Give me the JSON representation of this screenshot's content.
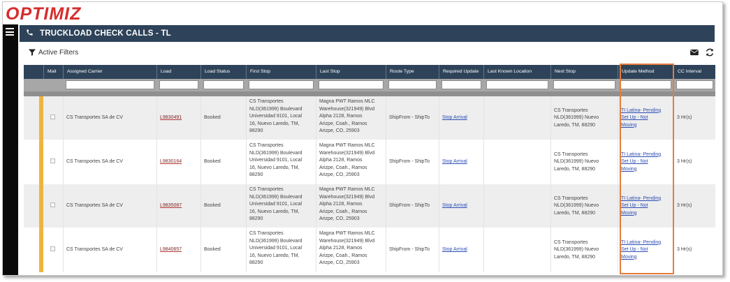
{
  "app": {
    "logo_text": "OPTIMIZ"
  },
  "header": {
    "title": "TRUCKLOAD CHECK CALLS - TL",
    "title_icon": "phone-icon"
  },
  "toolbar": {
    "filter_label": "Active Filters",
    "icons": [
      "mail-icon",
      "refresh-icon"
    ]
  },
  "columns": [
    "Mail",
    "Assigned Carrier",
    "Load",
    "Load Status",
    "First Stop",
    "Last Stop",
    "Route Type",
    "Required Update",
    "Last Known Location",
    "Next Stop",
    "Update Method",
    "CC Interval"
  ],
  "rows": [
    {
      "carrier": "CS Transportes SA de CV",
      "load": "L9830491",
      "status": "Booked",
      "first_stop": [
        "CS Transportes",
        "NLD(361999) Boulevard",
        "Universidad 9101, Local",
        "16, Nuevo Laredo, TM,",
        "88290"
      ],
      "last_stop": [
        "Magna PWT Ramos MLC",
        "Warehouse(321949) Blvd",
        "Alpha 2128, Ramos",
        "Arizpe, Coah., Ramos",
        "Arizpe, CO, 25903"
      ],
      "route_type": "ShipFrom - ShipTo",
      "required_update": "Stop Arrival",
      "next_stop": [
        "CS Transportes",
        "NLD(361999) Nuevo",
        "Laredo, TM, 88290"
      ],
      "update_method": [
        "TI Latina- Pending",
        "Set Up - Not",
        "Moving"
      ],
      "interval": "3 Hr(s)"
    },
    {
      "carrier": "CS Transportes SA de CV",
      "load": "L9830164",
      "status": "Booked",
      "first_stop": [
        "CS Transportes",
        "NLD(361999) Boulevard",
        "Universidad 9101, Local",
        "16, Nuevo Laredo, TM,",
        "88290"
      ],
      "last_stop": [
        "Magna PWT Ramos MLC",
        "Warehouse(321949) Blvd",
        "Alpha 2128, Ramos",
        "Arizpe, Coah., Ramos",
        "Arizpe, CO, 25903"
      ],
      "route_type": "ShipFrom - ShipTo",
      "required_update": "Stop Arrival",
      "next_stop": [
        "CS Transportes",
        "NLD(361999) Nuevo",
        "Laredo, TM, 88290"
      ],
      "update_method": [
        "TI Latina- Pending",
        "Set Up - Not",
        "Moving"
      ],
      "interval": "3 Hr(s)"
    },
    {
      "carrier": "CS Transportes SA de CV",
      "load": "L9835087",
      "status": "Booked",
      "first_stop": [
        "CS Transportes",
        "NLD(361999) Boulevard",
        "Universidad 9101, Local",
        "16, Nuevo Laredo, TM,",
        "88290"
      ],
      "last_stop": [
        "Magna PWT Ramos MLC",
        "Warehouse(321949) Blvd",
        "Alpha 2128, Ramos",
        "Arizpe, Coah., Ramos",
        "Arizpe, CO, 25903"
      ],
      "route_type": "ShipFrom - ShipTo",
      "required_update": "Stop Arrival",
      "next_stop": [
        "CS Transportes",
        "NLD(361999) Nuevo",
        "Laredo, TM, 88290"
      ],
      "update_method": [
        "TI Latina- Pending",
        "Set Up - Not",
        "Moving"
      ],
      "interval": "3 Hr(s)"
    },
    {
      "carrier": "CS Transportes SA de CV",
      "load": "L9840657",
      "status": "Booked",
      "first_stop": [
        "CS Transportes",
        "NLD(361999) Boulevard",
        "Universidad 9101, Local",
        "16, Nuevo Laredo, TM,",
        "88290"
      ],
      "last_stop": [
        "Magna PWT Ramos MLC",
        "Warehouse(321949) Blvd",
        "Alpha 2128, Ramos",
        "Arizpe, Coah., Ramos",
        "Arizpe, CO, 25903"
      ],
      "route_type": "ShipFrom - ShipTo",
      "required_update": "Stop Arrival",
      "next_stop": [
        "CS Transportes",
        "NLD(361999) Nuevo",
        "Laredo, TM, 88290"
      ],
      "update_method": [
        "TI Latina- Pending",
        "Set Up - Not",
        "Moving"
      ],
      "interval": "3 Hr(s)"
    }
  ],
  "colors": {
    "header_bg": "#2e4359",
    "logo_red": "#d62d2d",
    "row_accent": "#f0b43c",
    "highlight": "#e57c3a",
    "link": "#2b4cb3"
  }
}
